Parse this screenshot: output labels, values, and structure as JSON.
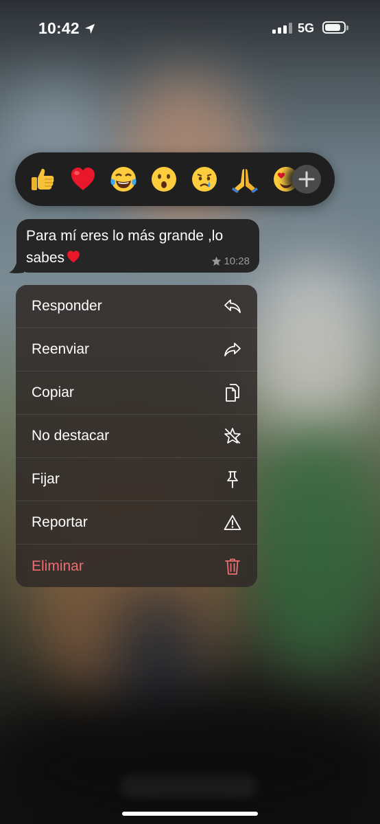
{
  "status_bar": {
    "time": "10:42",
    "network": "5G",
    "icons": [
      "location-arrow-icon",
      "signal-bars-icon",
      "battery-icon"
    ]
  },
  "reactions": {
    "emojis": [
      {
        "name": "thumbs-up-emoji",
        "char": "👍"
      },
      {
        "name": "red-heart-emoji",
        "char": "❤️"
      },
      {
        "name": "tears-of-joy-emoji",
        "char": "😂"
      },
      {
        "name": "surprised-face-emoji",
        "char": "😮"
      },
      {
        "name": "crying-face-emoji",
        "char": "😢"
      },
      {
        "name": "folded-hands-emoji",
        "char": "🙏"
      },
      {
        "name": "heart-eyes-emoji",
        "char": "😍"
      }
    ],
    "more_icon": "plus-icon"
  },
  "message": {
    "line1": "Para mí eres lo más grande ,lo",
    "line2": "sabes",
    "time": "10:28",
    "starred": true
  },
  "menu": {
    "items": [
      {
        "label": "Responder",
        "icon": "reply-icon"
      },
      {
        "label": "Reenviar",
        "icon": "forward-icon"
      },
      {
        "label": "Copiar",
        "icon": "copy-icon"
      },
      {
        "label": "No destacar",
        "icon": "unstar-icon"
      },
      {
        "label": "Fijar",
        "icon": "pin-icon"
      },
      {
        "label": "Reportar",
        "icon": "warning-icon"
      },
      {
        "label": "Eliminar",
        "icon": "trash-icon",
        "destructive": true
      }
    ]
  },
  "colors": {
    "destructive": "#ef6d72",
    "bubble": "#262626",
    "reaction_bar": "#1f1f1f"
  }
}
